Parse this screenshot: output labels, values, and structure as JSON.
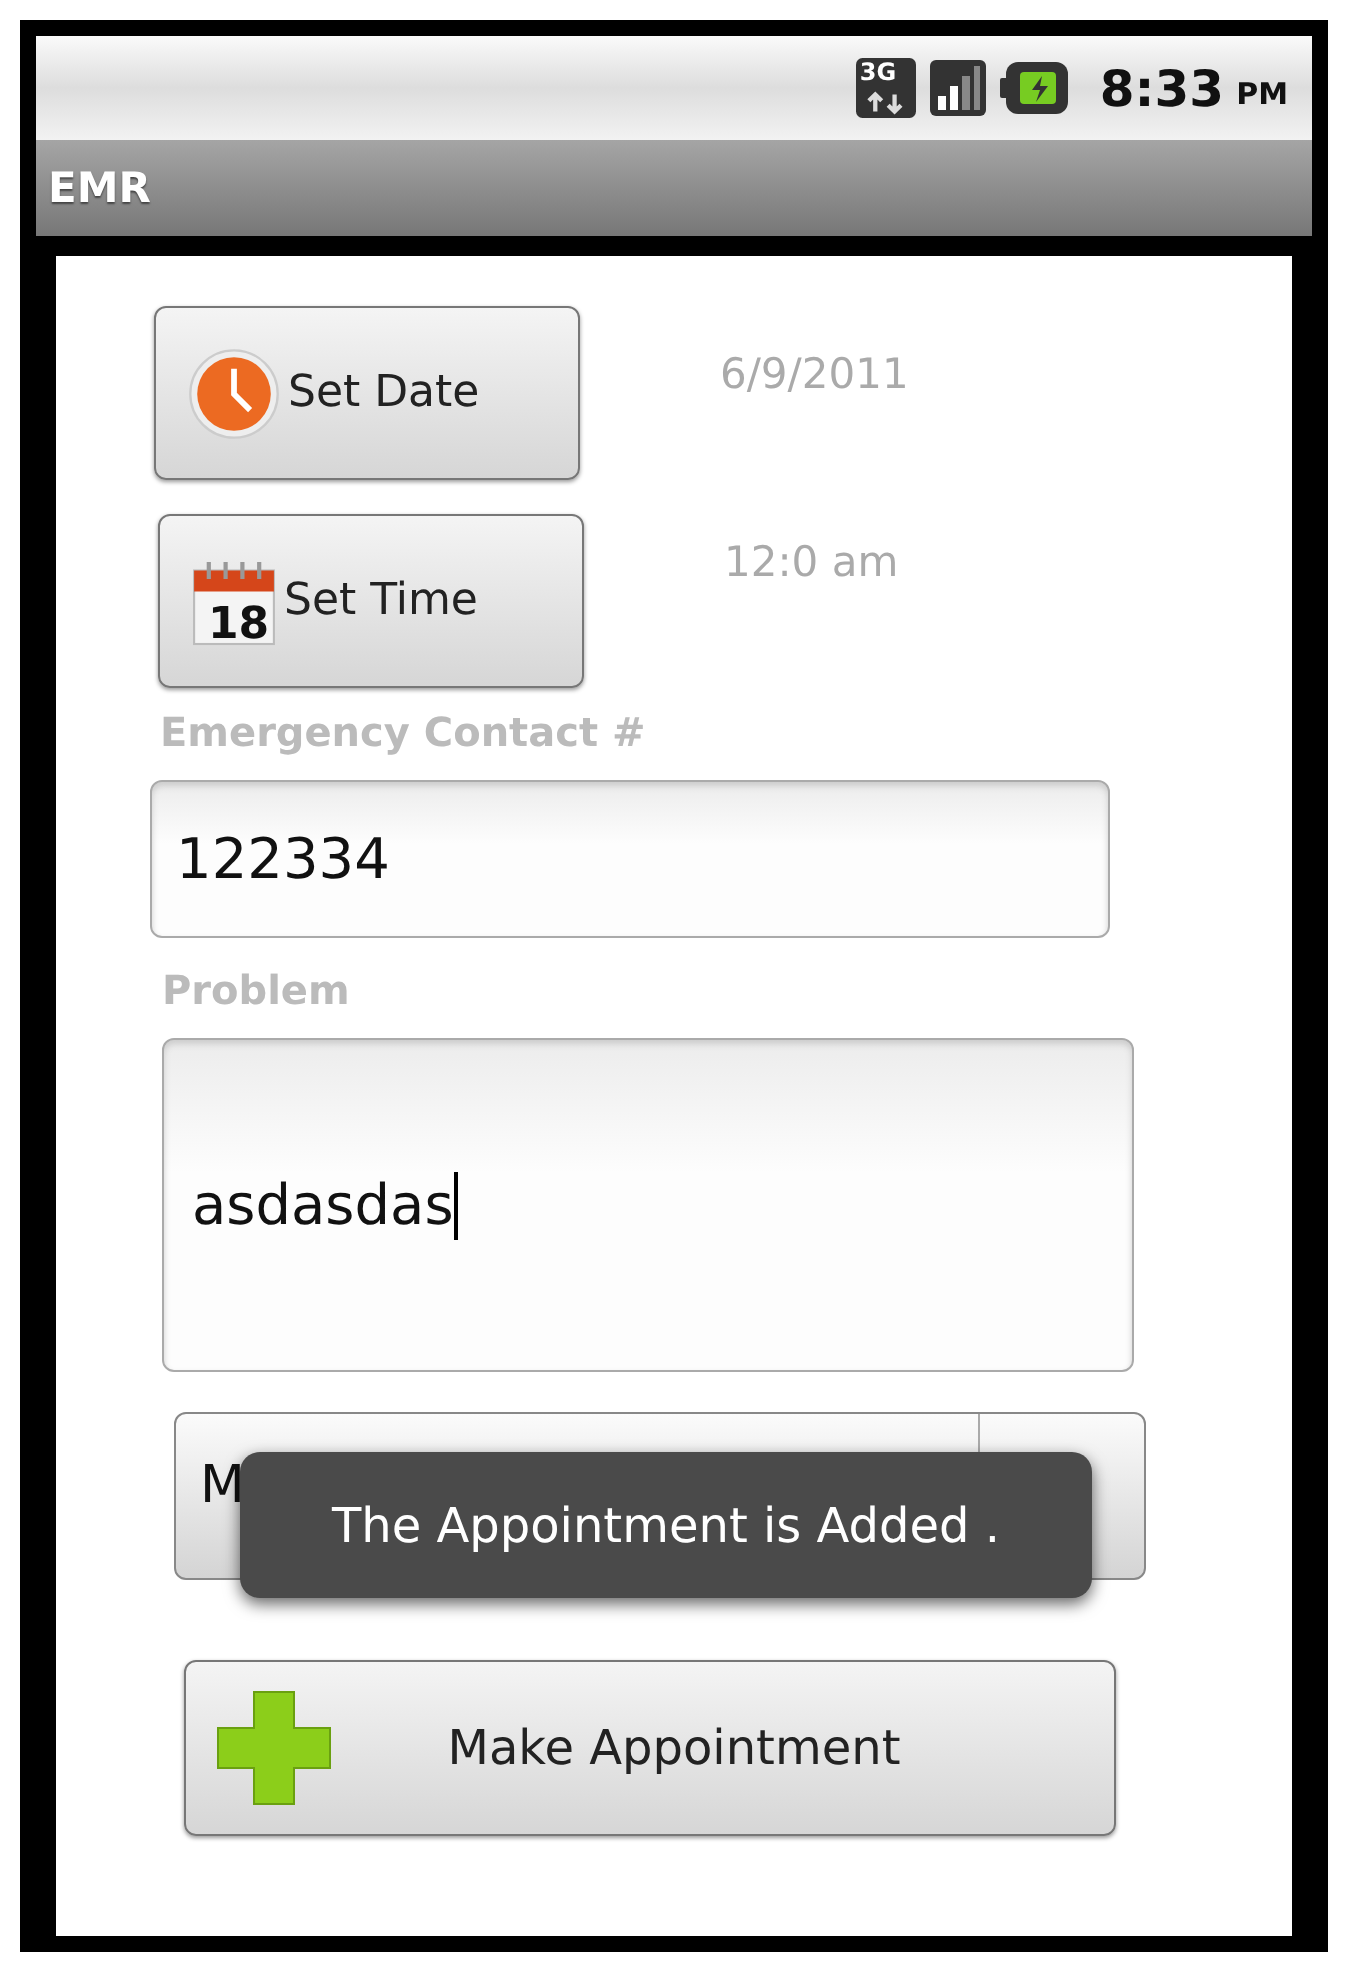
{
  "status_bar": {
    "network": "3G",
    "time": "8:33",
    "ampm": "PM"
  },
  "title_bar": {
    "title": "EMR"
  },
  "date_row": {
    "button": "Set Date",
    "value": "6/9/2011"
  },
  "time_row": {
    "button": "Set Time",
    "value": "12:0 am",
    "calendar_day": "18"
  },
  "contact": {
    "label": "Emergency Contact #",
    "value": "122334"
  },
  "problem": {
    "label": "Problem",
    "value": "asdasdas"
  },
  "doctor_spinner": {
    "value": "M"
  },
  "toast": {
    "message": "The Appointment is Added ."
  },
  "make_button": {
    "label": "Make Appointment"
  }
}
